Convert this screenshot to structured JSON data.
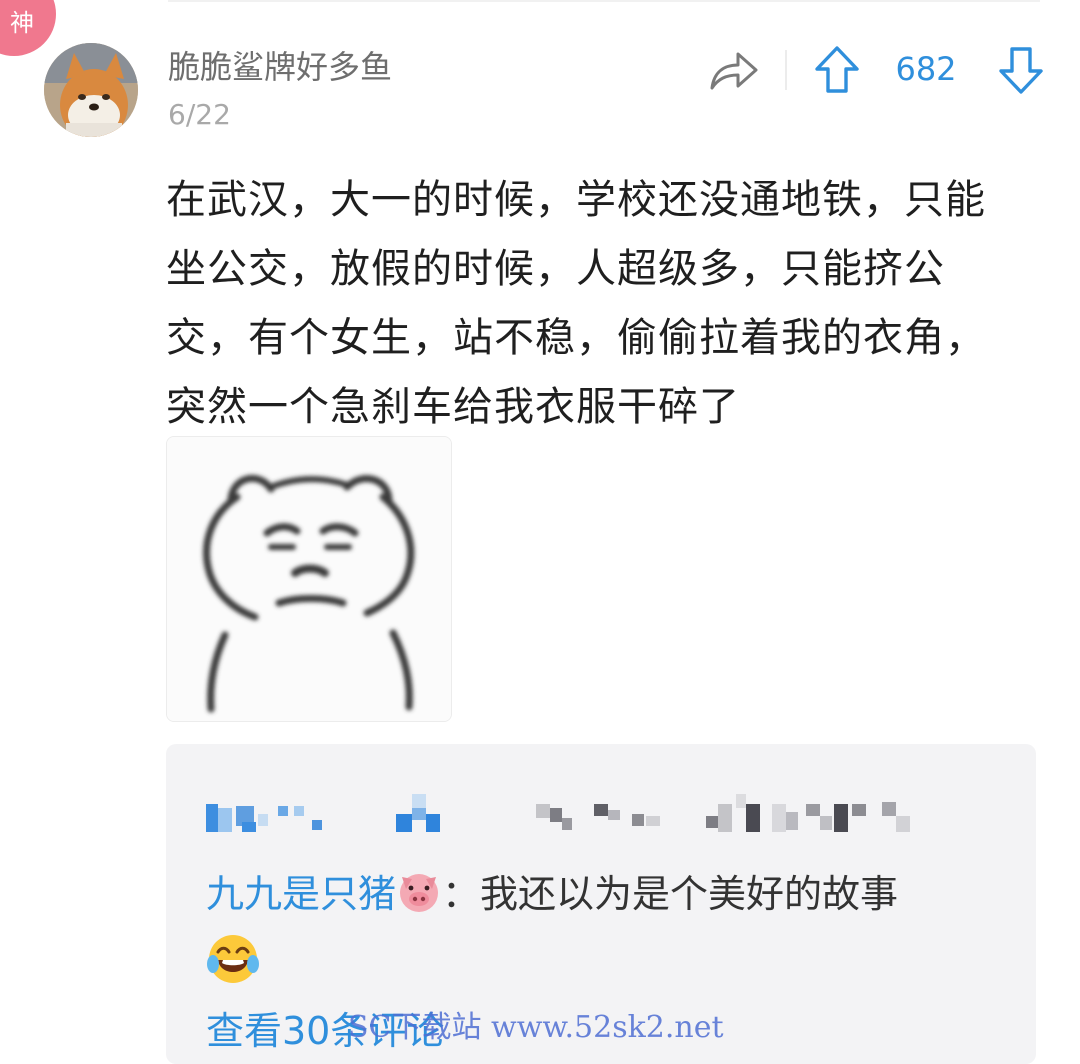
{
  "badge": {
    "label": "神",
    "color": "#f0788e"
  },
  "post": {
    "author": "脆脆鲨牌好多鱼",
    "date": "6/22",
    "votes": "682",
    "text": "在武汉，大一的时候，学校还没通地铁，只能坐公交，放假的时候，人超级多，只能挤公交，有个女生，站不稳，偷偷拉着我的衣角，突然一个急刹车给我衣服干碎了",
    "icons": {
      "share": "share-arrow-icon",
      "upvote": "arrow-up-icon",
      "downvote": "arrow-down-icon"
    }
  },
  "image": {
    "name": "bear-meme-sticker"
  },
  "comments": {
    "reply_author": "九九是只猪",
    "reply_author_emoji": "pig-face-emoji",
    "reply_separator": "：",
    "reply_text": "我还以为是个美好的故事",
    "reply_emoji": "laughing-tears-emoji",
    "view_more": "查看30条评论"
  },
  "watermark": "SC下载站 www.52sk2.net",
  "colors": {
    "accent": "#2f8fdc",
    "panel_bg": "#f3f3f5",
    "badge": "#f0788e"
  }
}
